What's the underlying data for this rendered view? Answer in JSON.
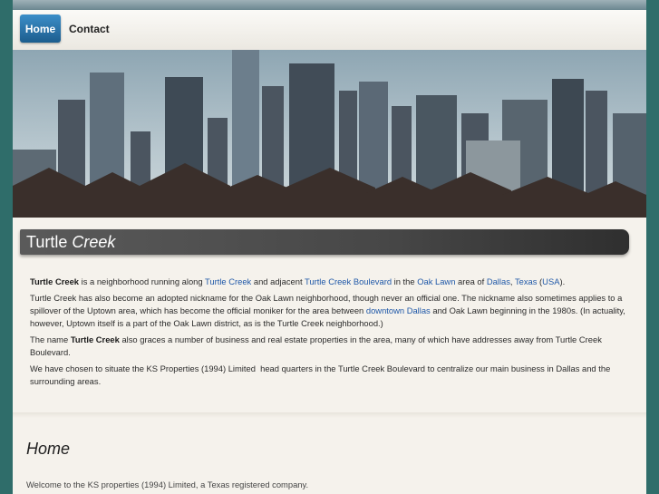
{
  "nav": {
    "items": [
      {
        "label": "Home"
      },
      {
        "label": "Contact"
      }
    ]
  },
  "title": {
    "part1": "Turtle",
    "part2": "Creek"
  },
  "paragraphs": {
    "p1": {
      "b1": "Turtle Creek",
      "t1": " is a neighborhood running along ",
      "l1": "Turtle Creek",
      "t2": " and adjacent ",
      "l2": "Turtle Creek Boulevard",
      "t3": " in the ",
      "l3": "Oak Lawn",
      "t4": " area of ",
      "l4": "Dallas",
      "t5": ", ",
      "l5": "Texas",
      "t6": " (",
      "l6": "USA",
      "t7": ")."
    },
    "p2": {
      "t1": "Turtle Creek has also become an adopted nickname for the Oak Lawn neighborhood, though never an official one. The nickname also sometimes applies to a spillover of the Uptown area, which has become the official moniker for the area between ",
      "l1": "downtown Dallas",
      "t2": " and Oak Lawn beginning in the 1980s. (In actuality, however, Uptown itself is a part of the Oak Lawn district, as is the Turtle Creek neighborhood.)"
    },
    "p3": {
      "t1": "The name ",
      "b1": "Turtle Creek",
      "t2": " also graces a number of business and real estate properties in the area, many of which have addresses away from Turtle Creek Boulevard."
    },
    "p4": "We have chosen to situate the KS Properties (1994) Limited  head quarters in the Turtle Creek Boulevard to centralize our main business in Dallas and the surrounding areas."
  },
  "home_heading": "Home",
  "welcome": "Welcome to the KS properties (1994) Limited, a Texas registered company.",
  "colors": {
    "background": "#2f6d6a",
    "nav_active": "#2a77b0",
    "link": "#1f58a8",
    "title_bar": "#474747"
  }
}
